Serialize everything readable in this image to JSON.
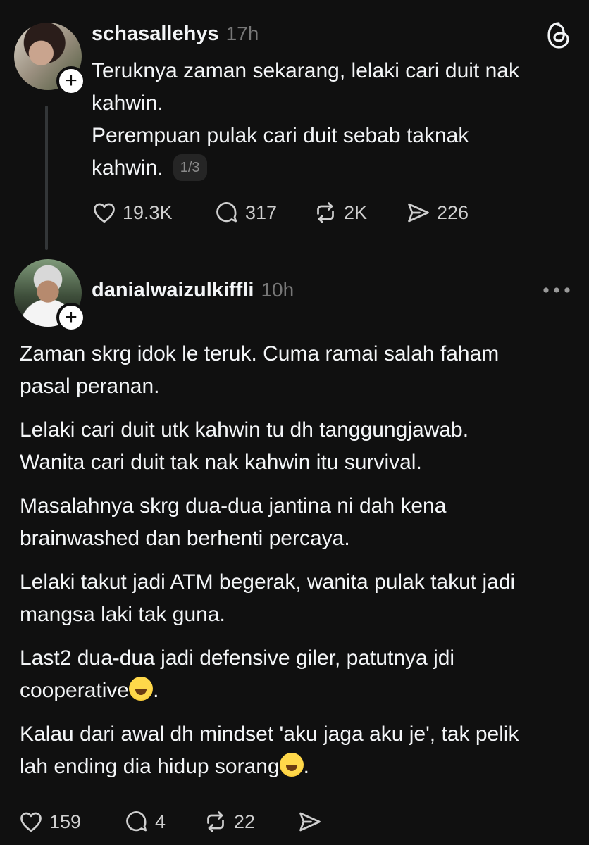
{
  "post1": {
    "username": "schasallehys",
    "time": "17h",
    "lines": [
      "Teruknya zaman sekarang, lelaki cari duit nak",
      "kahwin.",
      "Perempuan pulak cari duit sebab taknak",
      "kahwin."
    ],
    "pager": "1/3",
    "likes": "19.3K",
    "replies": "317",
    "reposts": "2K",
    "shares": "226"
  },
  "post2": {
    "username": "danialwaizulkiffli",
    "time": "10h",
    "p1": [
      "Zaman skrg idok le teruk. Cuma ramai salah faham",
      "pasal peranan."
    ],
    "p2": [
      "Lelaki cari duit utk kahwin tu dh tanggungjawab.",
      "Wanita cari duit tak nak kahwin itu survival."
    ],
    "p3": [
      "Masalahnya skrg dua-dua jantina ni dah kena",
      "brainwashed dan berhenti percaya."
    ],
    "p4": [
      "Lelaki takut jadi ATM begerak, wanita pulak takut jadi",
      "mangsa laki tak guna."
    ],
    "p5": [
      "Last2 dua-dua jadi defensive giler, patutnya jdi",
      "cooperative",
      "."
    ],
    "p6": [
      "Kalau dari awal dh mindset 'aku jaga aku je', tak pelik",
      "lah ending dia hidup sorang",
      "."
    ],
    "emoji1": "sweat-smile-emoji",
    "emoji2": "hand-over-mouth-emoji",
    "likes": "159",
    "replies": "4",
    "reposts": "22"
  },
  "icons": {
    "threads_logo": "threads-logo-icon",
    "more": "more-icon",
    "follow": "+"
  },
  "colors": {
    "background": "#101010",
    "text": "#f3f5f7",
    "muted": "#777777"
  }
}
